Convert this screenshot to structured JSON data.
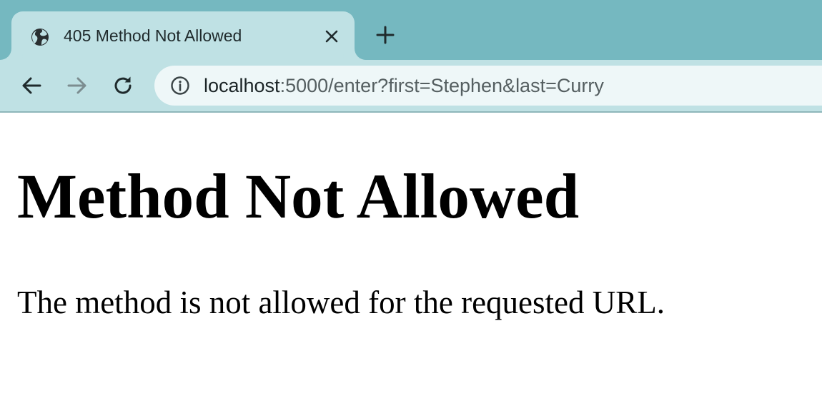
{
  "tab": {
    "title": "405 Method Not Allowed",
    "favicon": "globe-icon"
  },
  "toolbar": {
    "back_icon": "back-arrow-icon",
    "forward_icon": "forward-arrow-icon",
    "reload_icon": "reload-icon"
  },
  "address_bar": {
    "host": "localhost",
    "rest": ":5000/enter?first=Stephen&last=Curry",
    "icon": "info-icon"
  },
  "page": {
    "heading": "Method Not Allowed",
    "message": "The method is not allowed for the requested URL."
  },
  "colors": {
    "tab_strip": "#75b8c0",
    "active_tab": "#bfe1e4",
    "omnibox": "#eef7f8"
  }
}
